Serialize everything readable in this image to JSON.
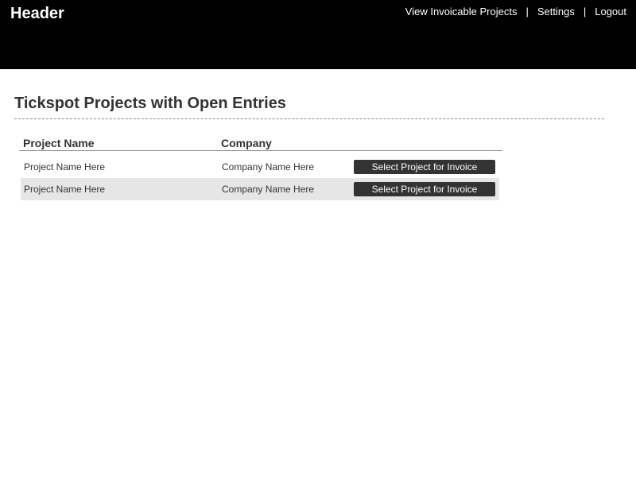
{
  "header": {
    "title": "Header",
    "nav": {
      "view_invoicable": "View Invoicable Projects",
      "separator": "|",
      "settings": "Settings",
      "logout": "Logout"
    }
  },
  "main": {
    "title": "Tickspot Projects with Open Entries",
    "table": {
      "columns": [
        "Project Name",
        "Company"
      ],
      "rows": [
        {
          "project": "Project Name Here",
          "company": "Company Name Here",
          "action": "Select Project for Invoice"
        },
        {
          "project": "Project Name Here",
          "company": "Company Name Here",
          "action": "Select Project for Invoice"
        }
      ]
    }
  },
  "colors": {
    "header_bg": "#000000",
    "button_bg": "#333333",
    "alt_row_bg": "#e6e6e6",
    "text": "#333333"
  }
}
